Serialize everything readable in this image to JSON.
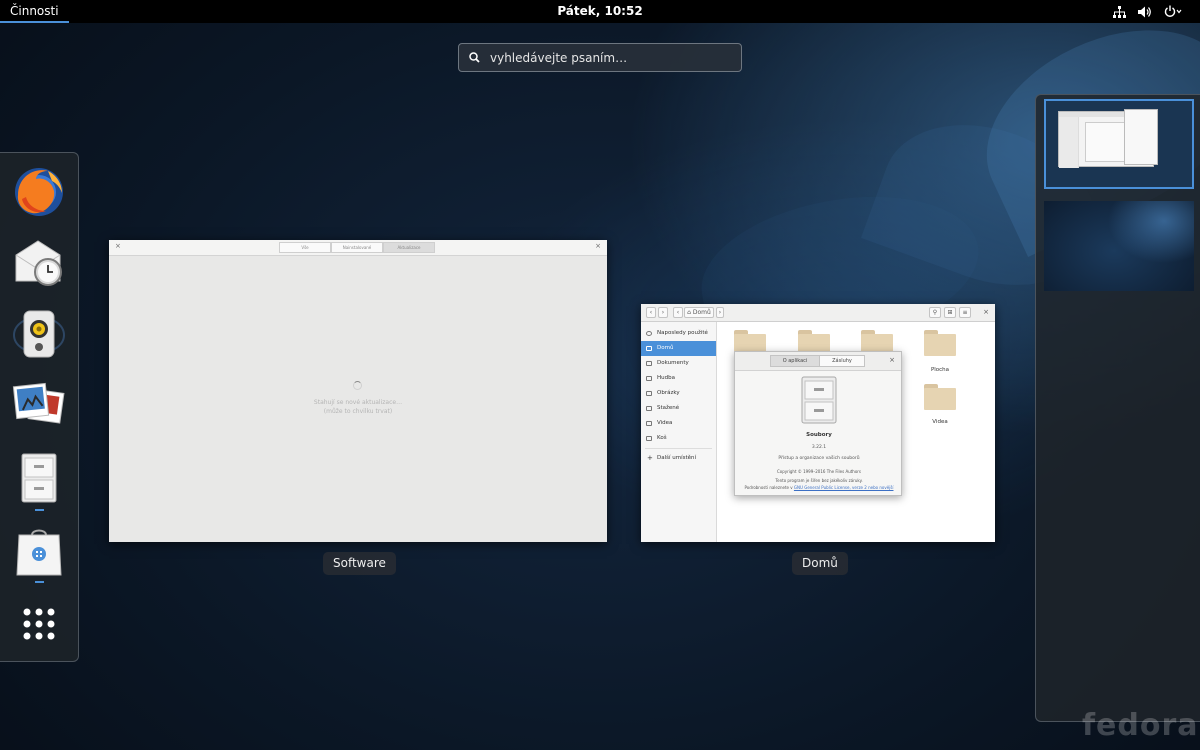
{
  "topbar": {
    "activities_label": "Činnosti",
    "clock": "Pátek, 10:52",
    "icons": [
      "network-icon",
      "volume-icon",
      "power-icon"
    ]
  },
  "search": {
    "placeholder": "vyhledávejte psaním…"
  },
  "dash": {
    "items": [
      {
        "name": "firefox",
        "icon": "firefox-icon",
        "running": false
      },
      {
        "name": "evolution",
        "icon": "mail-clock-icon",
        "running": false
      },
      {
        "name": "rhythmbox",
        "icon": "speaker-icon",
        "running": false
      },
      {
        "name": "shotwell",
        "icon": "photos-icon",
        "running": false
      },
      {
        "name": "files",
        "icon": "file-cabinet-icon",
        "running": true
      },
      {
        "name": "software",
        "icon": "software-bag-icon",
        "running": true
      },
      {
        "name": "show-apps",
        "icon": "app-grid-icon",
        "running": false
      }
    ]
  },
  "windows": {
    "software": {
      "label": "Software",
      "tabs": [
        "Vše",
        "Nainstalované",
        "Aktualizace"
      ],
      "message_line1": "Stahují se nové aktualizace…",
      "message_line2": "(může to chvilku trvat)"
    },
    "files": {
      "label": "Domů",
      "path": "Domů",
      "sidebar": [
        "Naposledy použité",
        "Domů",
        "Dokumenty",
        "Hudba",
        "Obrázky",
        "Stažené",
        "Videa",
        "Koš",
        "Další umístění"
      ],
      "folders": [
        "Plocha",
        "Videa"
      ],
      "about": {
        "tabs": [
          "O aplikaci",
          "Zásluhy"
        ],
        "name": "Soubory",
        "version": "3.22.1",
        "description": "Přístup a organizace vašich souborů",
        "copyright": "Copyright © 1999–2016 The Files Authors",
        "warranty": "Tento program je šířen bez jakékoliv záruky.",
        "license_prefix": "Podrobnosti naleznete v",
        "license_link": "GNU General Public License, verze 2 nebo novější"
      }
    }
  },
  "branding": "fedora",
  "colors": {
    "accent": "#4a90d9",
    "topbar": "#000000"
  }
}
